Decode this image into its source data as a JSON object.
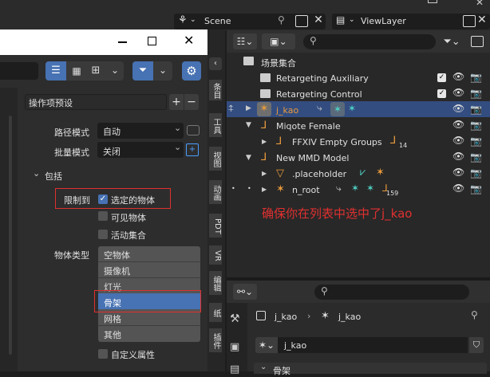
{
  "topbar": {
    "scene_label": "Scene",
    "viewlayer_label": "ViewLayer"
  },
  "left_panel": {
    "preset_label": "操作项预设",
    "path_mode_label": "路径模式",
    "path_mode_value": "自动",
    "batch_mode_label": "批量模式",
    "batch_mode_value": "关闭",
    "include_label": "包括",
    "limit_to_label": "限制到",
    "checkboxes": [
      {
        "label": "选定的物体",
        "checked": true
      },
      {
        "label": "可见物体",
        "checked": false
      },
      {
        "label": "活动集合",
        "checked": false
      }
    ],
    "object_type_label": "物体类型",
    "object_types": [
      "空物体",
      "摄像机",
      "灯光",
      "骨架",
      "网格",
      "其他"
    ],
    "selected_object_type": "骨架",
    "custom_props_label": "自定义属性"
  },
  "side_tabs": [
    "条目",
    "工具",
    "视图",
    "动画",
    "PDT",
    "VR",
    "编辑",
    "纸",
    "插件"
  ],
  "outliner": {
    "scene_collection": "场景集合",
    "rows": [
      {
        "label": "Retargeting Auxiliary"
      },
      {
        "label": "Retargeting Control"
      },
      {
        "label": "j_kao"
      },
      {
        "label": "Miqote Female"
      },
      {
        "label": "FFXIV Empty Groups",
        "badge": "14"
      },
      {
        "label": "New MMD Model"
      },
      {
        "label": ".placeholder"
      },
      {
        "label": "n_root",
        "badge": "159"
      }
    ]
  },
  "annotation": "确保你在列表中选中了j_kao",
  "properties": {
    "breadcrumb_1": "j_kao",
    "breadcrumb_2": "j_kao",
    "name_value": "j_kao",
    "section_label": "骨架"
  },
  "colors": {
    "highlight": "#334d80",
    "accent_blue": "#4772b3",
    "annotation_red": "#e03030",
    "select_orange": "#e89a3c"
  }
}
